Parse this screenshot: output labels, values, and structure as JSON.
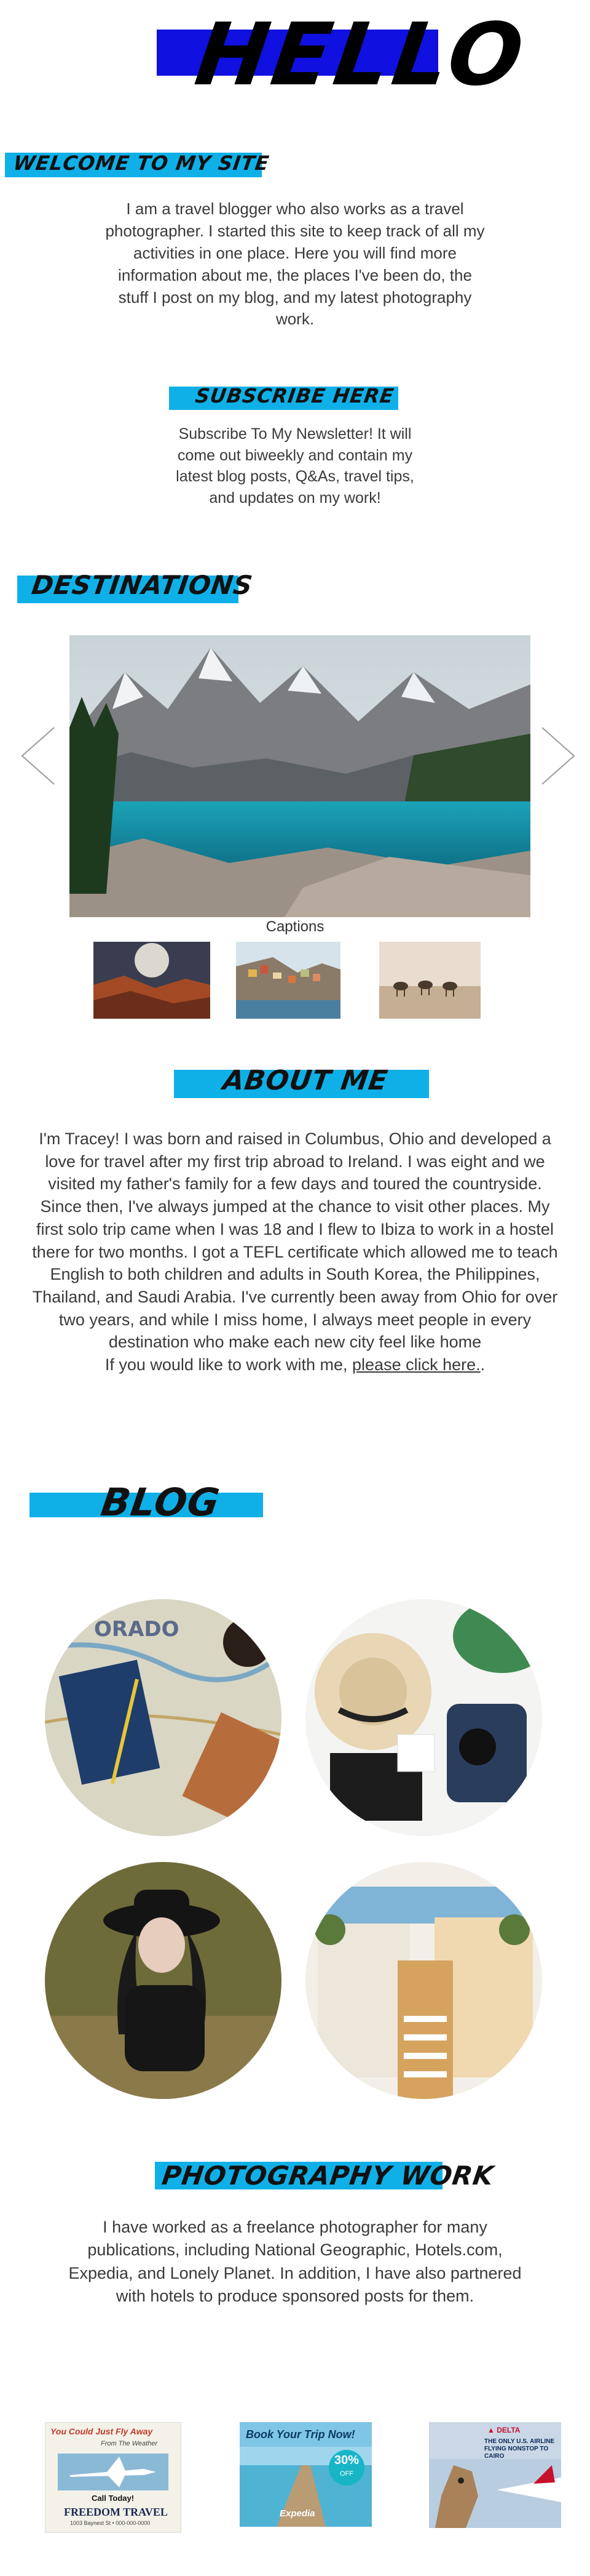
{
  "header": {
    "title": "HELLO"
  },
  "welcome": {
    "heading": "WELCOME TO MY SITE",
    "body": "I am a travel blogger who also works as a travel photographer. I started this site to keep track of all my activities in one place. Here you will find more information about me, the places I've been do, the stuff I post on my blog, and my latest photography work."
  },
  "subscribe": {
    "heading": "SUBSCRIBE HERE",
    "body": "Subscribe To My Newsletter! It will come out biweekly and contain my latest blog posts, Q&As, travel tips, and updates on my work!"
  },
  "destinations": {
    "heading": "DESTINATIONS",
    "caption": "Captions",
    "thumbs": [
      "canyon",
      "cliff-village",
      "desert-camels"
    ]
  },
  "about": {
    "heading": "ABOUT ME",
    "body": "I'm Tracey! I was born and raised in Columbus, Ohio and developed a love for travel after my first trip abroad to Ireland. I was eight and we visited my father's family for a few days and toured the countryside. Since then, I've always jumped at the chance to visit other places. My first solo trip came when I was 18 and I flew to Ibiza to work in a hostel there for two months. I got a TEFL certificate which allowed me to teach English to both children and adults in South Korea, the Philippines, Thailand, and Saudi Arabia. I've currently been away from Ohio for over two years, and while I miss home, I always meet people in every destination who make each new city feel like home",
    "work_prefix": "If you would like to work with me, ",
    "work_link": "please click here.",
    "work_suffix": "."
  },
  "blog": {
    "heading": "BLOG"
  },
  "photography": {
    "heading": "PHOTOGRAPHY WORK",
    "body": "I have worked as a freelance photographer for many publications, including National Geographic, Hotels.com, Expedia, and Lonely Planet. In addition, I have also partnered with hotels to produce sponsored posts for them.",
    "ads": {
      "ad1_line1": "You Could Just Fly Away",
      "ad1_line2": "From The Weather",
      "ad1_call": "Call Today!",
      "ad1_brand": "FREEDOM TRAVEL",
      "ad1_address": "1003 Baynest St • 000-000-0000",
      "ad2_title": "Book Your Trip Now!",
      "ad2_badge": "30%",
      "ad2_badge_sub": "OFF",
      "ad2_brand": "Expedia",
      "ad3_brand": "▲ DELTA",
      "ad3_text": "THE ONLY U.S. AIRLINE FLYING NONSTOP TO CAIRO"
    }
  },
  "colors": {
    "accent": "#0fb0e8",
    "slideshow_blue": "#1a8fa8",
    "hello_band": "#1010e0"
  }
}
